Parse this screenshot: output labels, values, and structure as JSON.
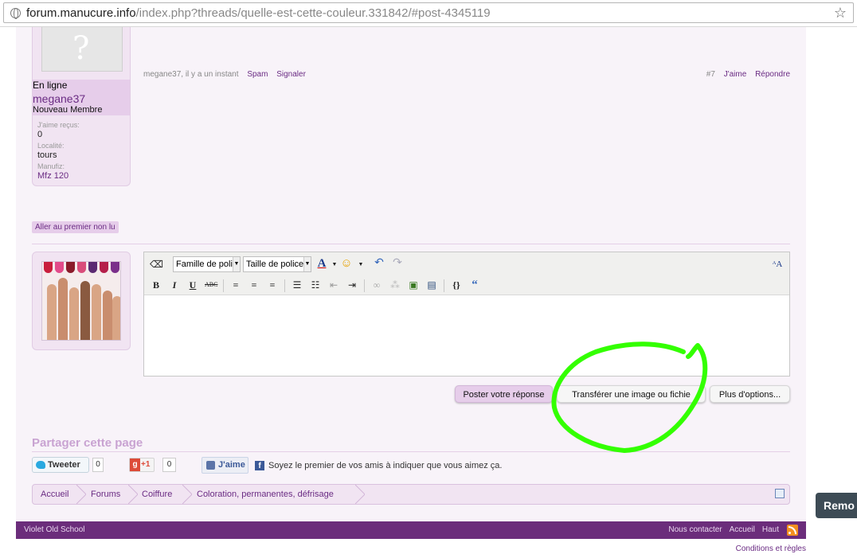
{
  "browser": {
    "url_host": "forum.manucure.info",
    "url_path": "/index.php?threads/quelle-est-cette-couleur.331842/#post-4345119"
  },
  "user_panel": {
    "status": "En ligne",
    "username": "megane37",
    "rank": "Nouveau Membre",
    "likes_label": "J'aime reçus:",
    "likes_value": "0",
    "locality_label": "Localité:",
    "locality_value": "tours",
    "manufiz_label": "Manufiz:",
    "manufiz_value": "Mfz 120"
  },
  "post_meta": {
    "author_time": "megane37, il y a un instant",
    "spam": "Spam",
    "report": "Signaler",
    "post_number": "#7",
    "like": "J'aime",
    "reply": "Répondre"
  },
  "unread_button": "Aller au premier non lu",
  "editor": {
    "font_family": "Famille de polic",
    "font_size": "Taille de police"
  },
  "buttons": {
    "post_reply": "Poster votre réponse",
    "upload": "Transférer une image ou fichie",
    "more_options": "Plus d'options..."
  },
  "share": {
    "title": "Partager cette page",
    "tweet": "Tweeter",
    "tweet_count": "0",
    "gplus": "+1",
    "gplus_count": "0",
    "fb_like": "J'aime",
    "fb_text": "Soyez le premier de vos amis à indiquer que vous aimez ça."
  },
  "breadcrumb": [
    "Accueil",
    "Forums",
    "Coiffure",
    "Coloration, permanentes, défrisage"
  ],
  "footer": {
    "style": "Violet Old School",
    "contact": "Nous contacter",
    "home": "Accueil",
    "top": "Haut",
    "terms": "Conditions et règles"
  },
  "side_tab": "Remo",
  "colors": {
    "accent": "#6b2d7b",
    "panel": "#f1e4f2",
    "annotation": "#33ff00"
  }
}
